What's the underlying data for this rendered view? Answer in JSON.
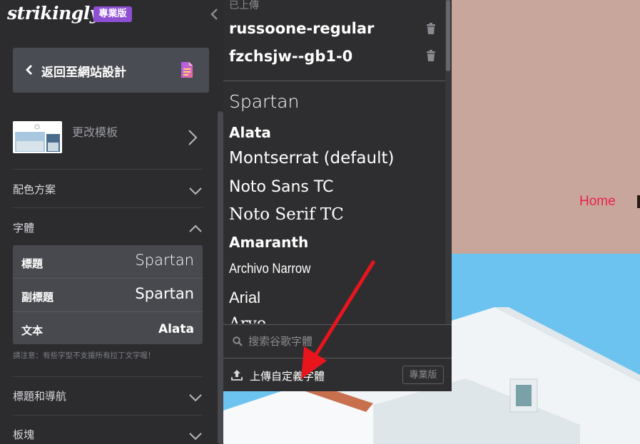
{
  "sidebar": {
    "logo": "strikingly",
    "pro_badge": "專業版",
    "back_button": "返回至網站設計",
    "template_label": "更改模板",
    "sections": {
      "color_scheme": "配色方案",
      "fonts": "字體",
      "header_nav": "標題和導航",
      "blocks": "板塊"
    },
    "font_rows": [
      {
        "label": "標題",
        "value": "Spartan"
      },
      {
        "label": "副標題",
        "value": "Spartan"
      },
      {
        "label": "文本",
        "value": "Alata"
      }
    ],
    "font_note": "請注意：有些字型不支援所有拉丁文字喔！"
  },
  "dropdown": {
    "uploaded_label": "已上傳",
    "uploaded_fonts": [
      "russoone-regular",
      "fzchsjw--gb1-0"
    ],
    "font_options": [
      "Spartan",
      "Alata",
      "Montserrat (default)",
      "Noto Sans TC",
      "Noto Serif TC",
      "Amaranth",
      "Archivo Narrow",
      "Arial",
      "Arvo"
    ],
    "search_placeholder": "搜索谷歌字體",
    "upload_label": "上傳自定義字體",
    "upload_badge": "專業版"
  },
  "preview": {
    "nav_home": "Home"
  },
  "colors": {
    "accent": "#8f4fd2",
    "nav_link": "#e8234a",
    "arrow": "#e8151d"
  }
}
